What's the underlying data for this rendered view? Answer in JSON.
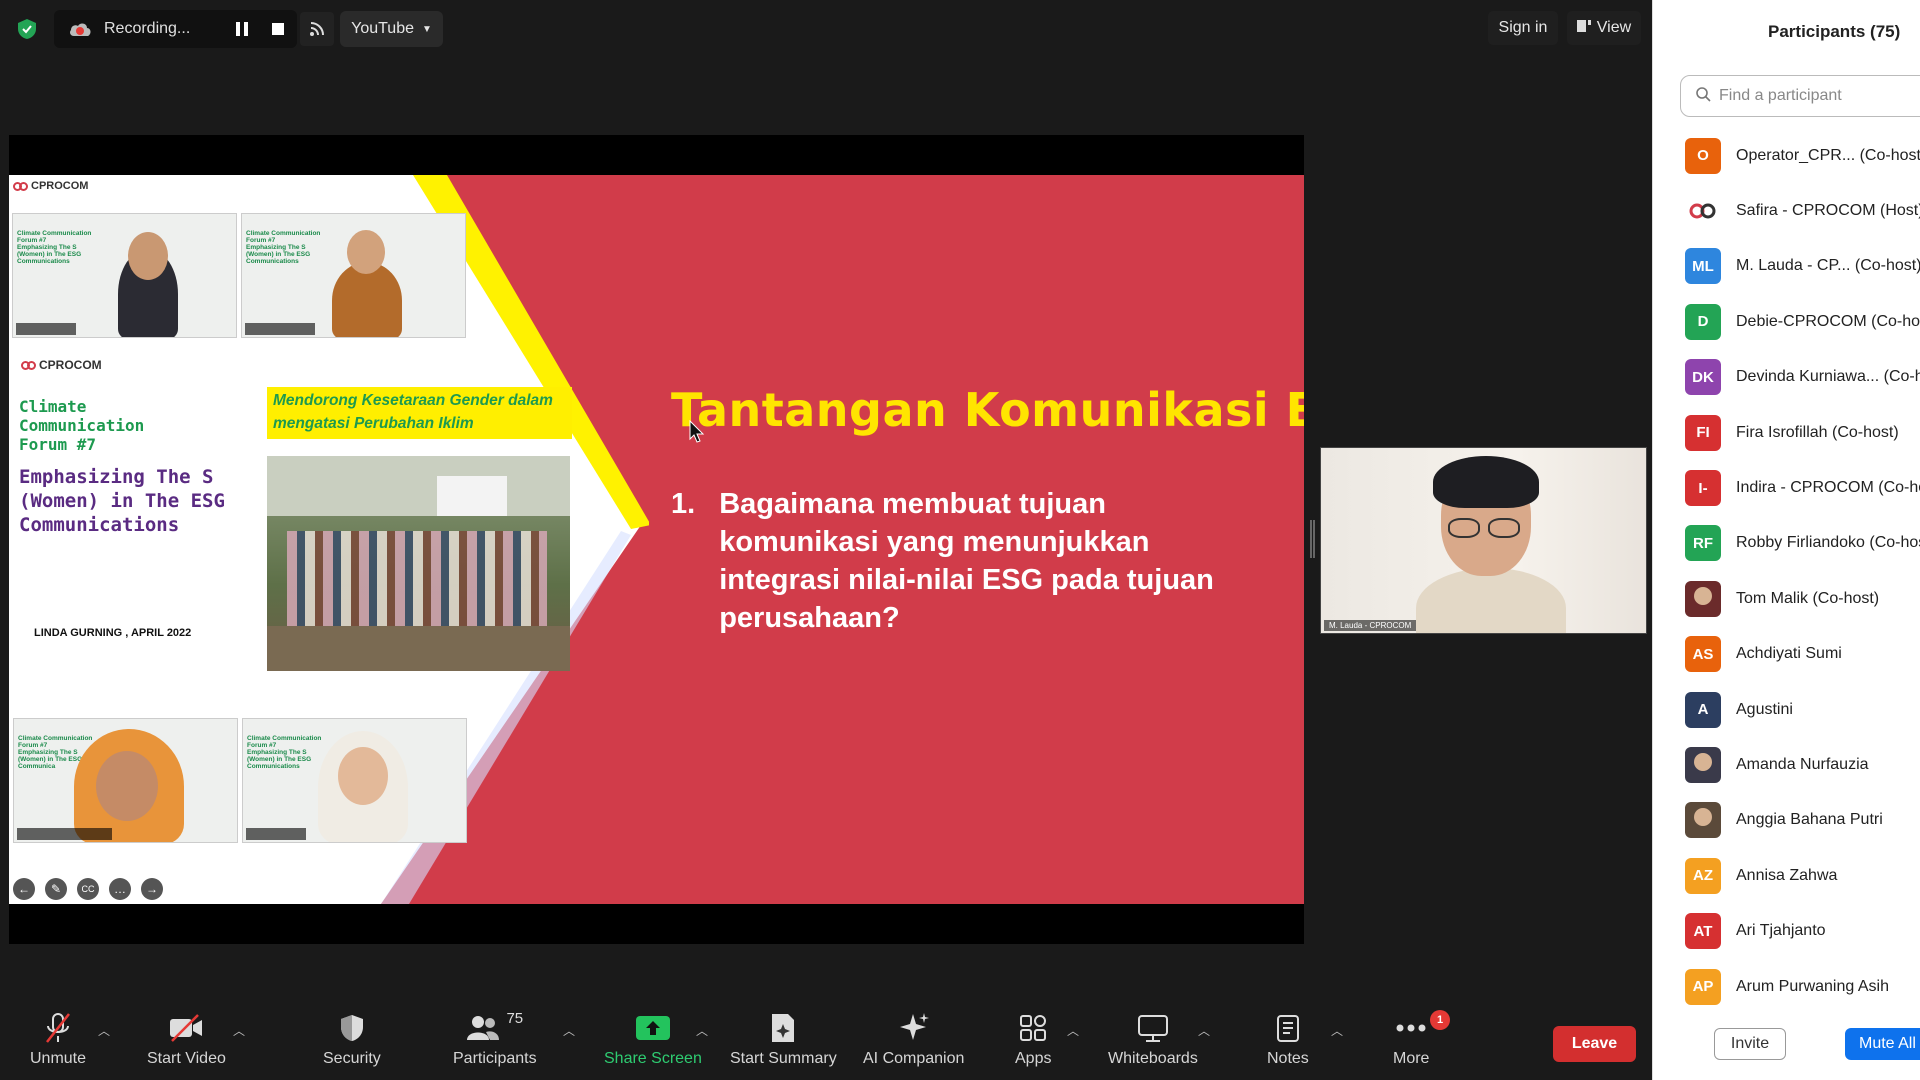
{
  "topbar": {
    "recording_text": "Recording...",
    "stream_target": "YouTube",
    "signin_label": "Sign in",
    "view_label": "View"
  },
  "slide": {
    "title": "Tantangan Komunikasi ESG:",
    "question_number": "1.",
    "question_text": "Bagaimana membuat tujuan komunikasi yang menunjukkan integrasi nilai-nilai ESG pada tujuan perusahaan?"
  },
  "inner_presentation": {
    "logo_text": "CPROCOM",
    "forum_title": "Climate Communication Forum #7",
    "forum_subtitle": "Emphasizing The S (Women) in The ESG Communications",
    "banner_text": "Mendorong Kesetaraan Gender dalam mengatasi Perubahan Iklim",
    "author": "LINDA GURNING , APRIL 2022"
  },
  "speaker": {
    "name": "M. Lauda - CPROCOM"
  },
  "toolbar": {
    "unmute": "Unmute",
    "start_video": "Start Video",
    "security": "Security",
    "participants": "Participants",
    "participants_count": "75",
    "share_screen": "Share Screen",
    "start_summary": "Start Summary",
    "ai_companion": "AI Companion",
    "apps": "Apps",
    "whiteboards": "Whiteboards",
    "notes": "Notes",
    "more": "More",
    "more_badge": "1",
    "leave": "Leave"
  },
  "panel": {
    "title": "Participants (75)",
    "search_placeholder": "Find a participant",
    "invite": "Invite",
    "mute_all": "Mute All",
    "participants": [
      {
        "initials": "O",
        "name": "Operator_CPR... (Co-host)",
        "color": "#e8620c"
      },
      {
        "initials": "",
        "name": "Safira - CPROCOM (Host)",
        "color": "#ffffff"
      },
      {
        "initials": "ML",
        "name": "M. Lauda - CP... (Co-host)",
        "color": "#2e86de"
      },
      {
        "initials": "D",
        "name": "Debie-CPROCOM (Co-host)",
        "color": "#23a455"
      },
      {
        "initials": "DK",
        "name": "Devinda Kurniawa... (Co-host)",
        "color": "#8e44ad"
      },
      {
        "initials": "FI",
        "name": "Fira Isrofillah (Co-host)",
        "color": "#d63031"
      },
      {
        "initials": "I-",
        "name": "Indira - CPROCOM (Co-host)",
        "color": "#d63031"
      },
      {
        "initials": "RF",
        "name": "Robby Firliandoko (Co-host)",
        "color": "#23a455"
      },
      {
        "initials": "",
        "name": "Tom Malik (Co-host)",
        "color": "#6b2b2b"
      },
      {
        "initials": "AS",
        "name": "Achdiyati Sumi",
        "color": "#e8620c"
      },
      {
        "initials": "A",
        "name": "Agustini",
        "color": "#2c3e60"
      },
      {
        "initials": "",
        "name": "Amanda Nurfauzia",
        "color": "#3a3a4a"
      },
      {
        "initials": "",
        "name": "Anggia Bahana Putri",
        "color": "#5b4a3a"
      },
      {
        "initials": "AZ",
        "name": "Annisa Zahwa",
        "color": "#f4a021"
      },
      {
        "initials": "AT",
        "name": "Ari Tjahjanto",
        "color": "#d63031"
      },
      {
        "initials": "AP",
        "name": "Arum Purwaning Asih",
        "color": "#f4a021"
      }
    ]
  }
}
